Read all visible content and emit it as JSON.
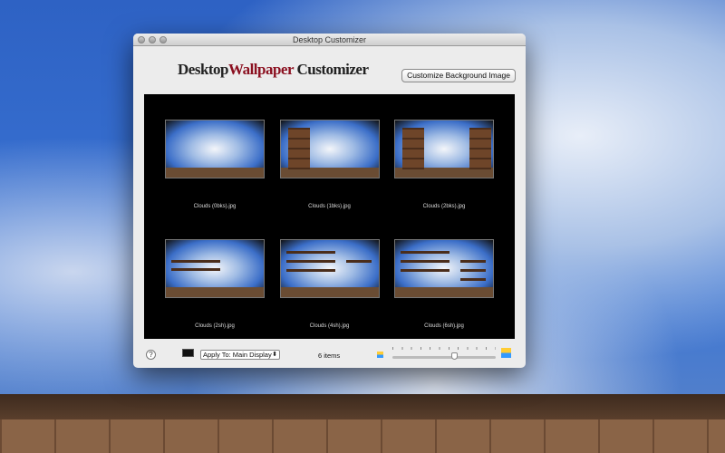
{
  "window": {
    "title": "Desktop Customizer"
  },
  "header": {
    "logo_part1": "Desktop",
    "logo_part2": "Wallpaper",
    "logo_part3": " Customizer",
    "customize_button": "Customize Background Image"
  },
  "items": [
    {
      "label": "Clouds (0bks).jpg",
      "bookcases": 0,
      "shelves": 0
    },
    {
      "label": "Clouds (1bks).jpg",
      "bookcases": 1,
      "shelves": 0
    },
    {
      "label": "Clouds (2bks).jpg",
      "bookcases": 2,
      "shelves": 0
    },
    {
      "label": "Clouds (2sh).jpg",
      "bookcases": 0,
      "shelves": 2
    },
    {
      "label": "Clouds (4sh).jpg",
      "bookcases": 0,
      "shelves": 4
    },
    {
      "label": "Clouds (6sh).jpg",
      "bookcases": 0,
      "shelves": 6
    }
  ],
  "footer": {
    "help": "?",
    "apply_select": "Apply To: Main Display",
    "item_count": "6 items",
    "thumb_size_slider": 0.6
  }
}
